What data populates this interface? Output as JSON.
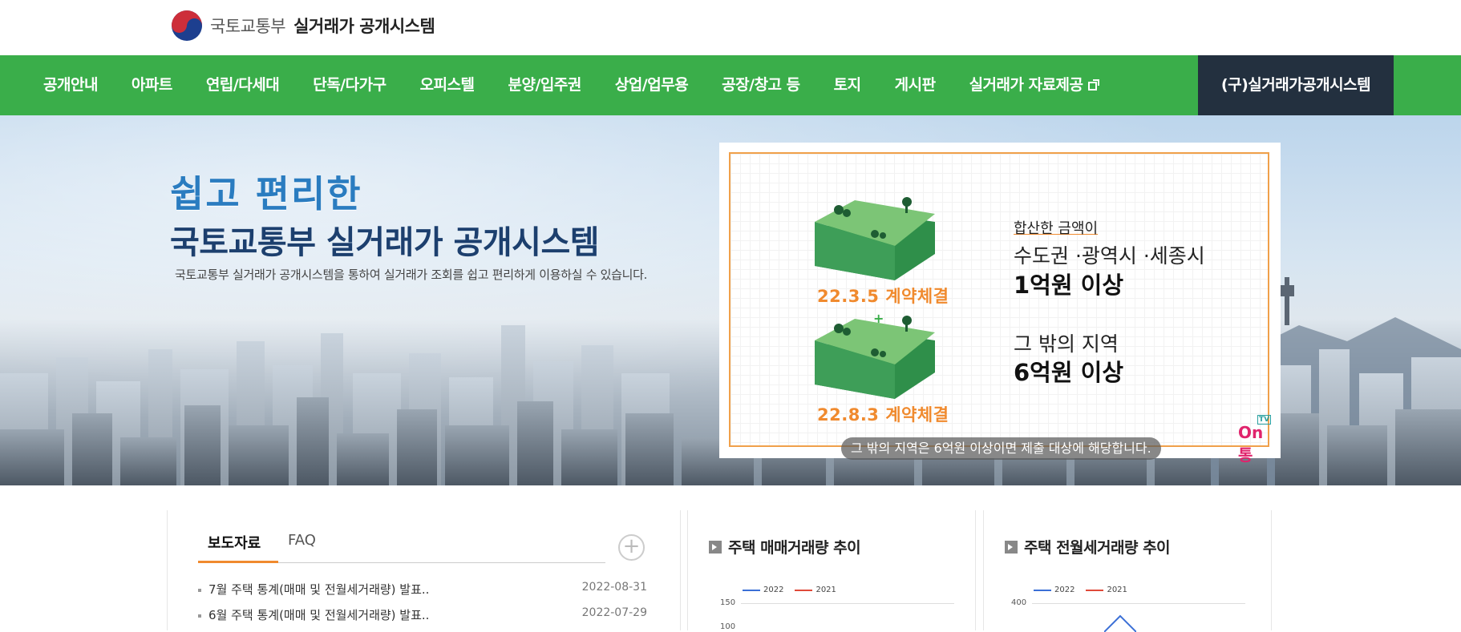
{
  "header": {
    "ministry": "국토교통부",
    "system": "실거래가 공개시스템"
  },
  "nav": {
    "items": [
      {
        "label": "공개안내"
      },
      {
        "label": "아파트"
      },
      {
        "label": "연립/다세대"
      },
      {
        "label": "단독/다가구"
      },
      {
        "label": "오피스텔"
      },
      {
        "label": "분양/입주권"
      },
      {
        "label": "상업/업무용"
      },
      {
        "label": "공장/창고 등"
      },
      {
        "label": "토지"
      },
      {
        "label": "게시판"
      },
      {
        "label": "실거래가 자료제공"
      }
    ],
    "old_system": "(구)실거래가공개시스템"
  },
  "hero": {
    "title1": "쉽고 편리한",
    "title2": "국토교통부 실거래가 공개시스템",
    "desc": "국토교통부 실거래가 공개시스템을 통하여 실거래가 조회를 쉽고 편리하게 이용하실 수 있습니다."
  },
  "notice": {
    "label_a": "22.3.5 계약체결",
    "plus": "+",
    "label_b": "22.8.3 계약체결",
    "note1": "합산한 금액이",
    "region1": "수도권 ·광역시 ·세종시",
    "amount1": "1억원 이상",
    "region2": "그 밖의 지역",
    "amount2": "6억원 이상",
    "caption": "그 밖의 지역은 6억원 이상이면 제출 대상에 해당합니다.",
    "brand_tv": "TV",
    "brand": "On통"
  },
  "news": {
    "tabs": [
      "보도자료",
      "FAQ"
    ],
    "more": "+",
    "rows": [
      {
        "title": "7월 주택 통계(매매 및 전월세거래량) 발표..",
        "date": "2022-08-31"
      },
      {
        "title": "6월 주택 통계(매매 및 전월세거래량) 발표..",
        "date": "2022-07-29"
      }
    ]
  },
  "sale_panel": {
    "title": "주택 매매거래량 추이",
    "legend": [
      {
        "name": "2022",
        "color": "#3b6fd6"
      },
      {
        "name": "2021",
        "color": "#e04a3a"
      }
    ],
    "y_top": "150",
    "y_next": "100"
  },
  "rent_panel": {
    "title": "주택 전월세거래량 추이",
    "legend": [
      {
        "name": "2022",
        "color": "#3b6fd6"
      },
      {
        "name": "2021",
        "color": "#e04a3a"
      }
    ],
    "y_top": "400"
  },
  "colors": {
    "nav_green": "#3aae4a",
    "nav_dark": "#23303f",
    "accent_orange": "#f08a2e"
  }
}
